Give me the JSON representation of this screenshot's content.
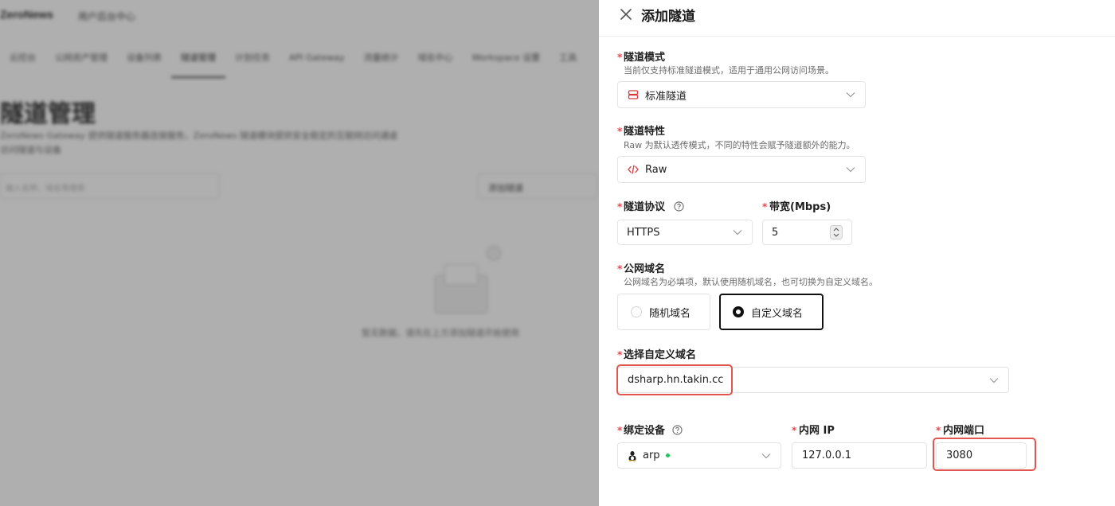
{
  "background": {
    "logo": "ZeroNews",
    "subtitle": "用户后台中心",
    "tabs": [
      "云控台",
      "公网资产管理",
      "设备列表",
      "隧道管理",
      "计划任务",
      "API Gateway",
      "流量统计",
      "域名中心",
      "Workspace 设置",
      "工具"
    ],
    "active_tab_index": 3,
    "page_title": "隧道管理",
    "description_line1": "ZeroNews Gateway 提供隧道服务器连接服务，ZeroNews 隧道模块提供安全稳定的互联网访问通道",
    "description_line2": "访问隧道与设备",
    "search_placeholder": "输入名称、域名等搜索",
    "action_button": "添加隧道",
    "empty_text": "暂无数据，请先在上方添加隧道开始使用"
  },
  "drawer": {
    "title": "添加隧道",
    "close_icon": "close-icon",
    "tunnel_mode": {
      "label": "隧道模式",
      "hint": "当前仅支持标准隧道模式，适用于通用公网访问场景。",
      "value": "标准隧道",
      "icon": "server-icon"
    },
    "tunnel_feature": {
      "label": "隧道特性",
      "hint": "Raw 为默认透传模式，不同的特性会赋予隧道额外的能力。",
      "value": "Raw",
      "icon": "code-icon"
    },
    "protocol": {
      "label": "隧道协议",
      "value": "HTTPS",
      "help_icon": "question-circle-icon"
    },
    "bandwidth": {
      "label": "带宽(Mbps)",
      "value": "5"
    },
    "domain": {
      "label": "公网域名",
      "hint": "公网域名为必填项，默认使用随机域名，也可切换为自定义域名。",
      "options": [
        "随机域名",
        "自定义域名"
      ],
      "selected_index": 1
    },
    "custom_domain": {
      "label": "选择自定义域名",
      "value": "dsharp.hn.takin.cc"
    },
    "device": {
      "label": "绑定设备",
      "value": "arp",
      "icon": "linux-icon",
      "status_color": "#22c55e"
    },
    "internal_ip": {
      "label": "内网 IP",
      "value": "127.0.0.1"
    },
    "internal_port": {
      "label": "内网端口",
      "value": "3080"
    }
  },
  "colors": {
    "required": "#e5484d",
    "highlight": "#e2564f",
    "accent_icon": "#d9363e",
    "border": "#e3e3e3"
  }
}
